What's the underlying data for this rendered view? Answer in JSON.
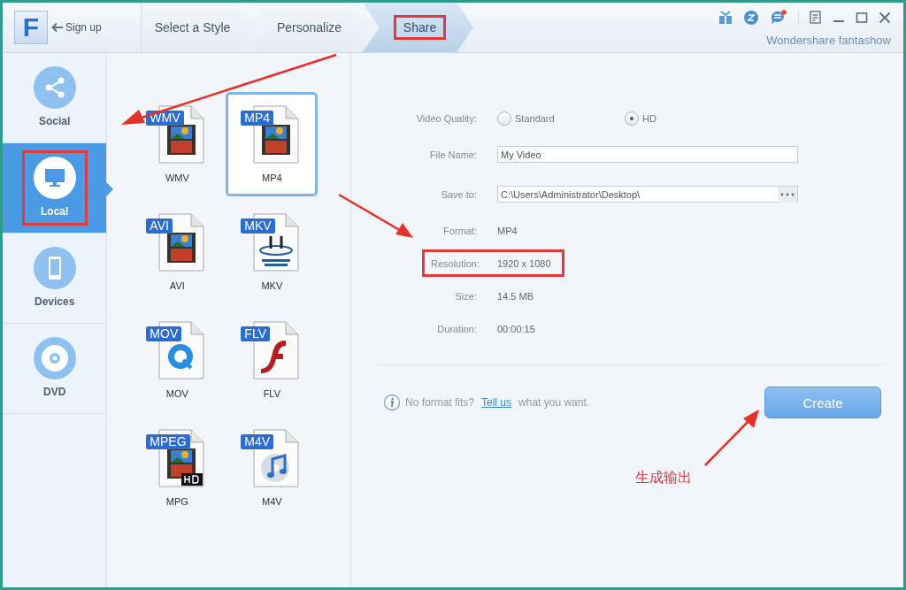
{
  "header": {
    "logo": "F",
    "sign_up": "Sign up",
    "steps": [
      {
        "label": "Select a Style",
        "selected": false,
        "highlighted": false
      },
      {
        "label": "Personalize",
        "selected": false,
        "highlighted": false
      },
      {
        "label": "Share",
        "selected": true,
        "highlighted": true
      }
    ],
    "notification": true,
    "brand": "Wondershare fantashow"
  },
  "sidebar": {
    "items": [
      {
        "label": "Social",
        "kind": "share",
        "selected": false,
        "highlighted": false
      },
      {
        "label": "Local",
        "kind": "monitor",
        "selected": true,
        "highlighted": true
      },
      {
        "label": "Devices",
        "kind": "phone",
        "selected": false,
        "highlighted": false
      },
      {
        "label": "DVD",
        "kind": "disc",
        "selected": false,
        "highlighted": false
      }
    ]
  },
  "formats": [
    {
      "badge": "WMV",
      "label": "WMV",
      "kind": "film",
      "selected": false
    },
    {
      "badge": "MP4",
      "label": "MP4",
      "kind": "film",
      "selected": true
    },
    {
      "badge": "AVI",
      "label": "AVI",
      "kind": "film",
      "selected": false
    },
    {
      "badge": "MKV",
      "label": "MKV",
      "kind": "matroska",
      "selected": false
    },
    {
      "badge": "MOV",
      "label": "MOV",
      "kind": "quicktime",
      "selected": false
    },
    {
      "badge": "FLV",
      "label": "FLV",
      "kind": "flash",
      "selected": false
    },
    {
      "badge": "MPEG",
      "label": "MPG",
      "kind": "film_hd",
      "selected": false
    },
    {
      "badge": "M4V",
      "label": "M4V",
      "kind": "music",
      "selected": false
    }
  ],
  "settings": {
    "quality": {
      "label": "Video Quality:",
      "options": [
        {
          "label": "Standard",
          "selected": false
        },
        {
          "label": "HD",
          "selected": true
        }
      ]
    },
    "file_name": {
      "label": "File Name:",
      "value": "My Video"
    },
    "save_to": {
      "label": "Save to:",
      "value": "C:\\Users\\Administrator\\Desktop\\"
    },
    "info": [
      {
        "label": "Format:",
        "value": "MP4",
        "highlighted": false
      },
      {
        "label": "Resolution:",
        "value": "1920 x 1080",
        "highlighted": true
      },
      {
        "label": "Size:",
        "value": "14.5 MB",
        "highlighted": false
      },
      {
        "label": "Duration:",
        "value": "00:00:15",
        "highlighted": false
      }
    ]
  },
  "footer": {
    "before": "No format fits?",
    "link": "Tell us",
    "after": "what you want.",
    "button": "Create"
  },
  "annotation": {
    "note": "生成输出"
  }
}
